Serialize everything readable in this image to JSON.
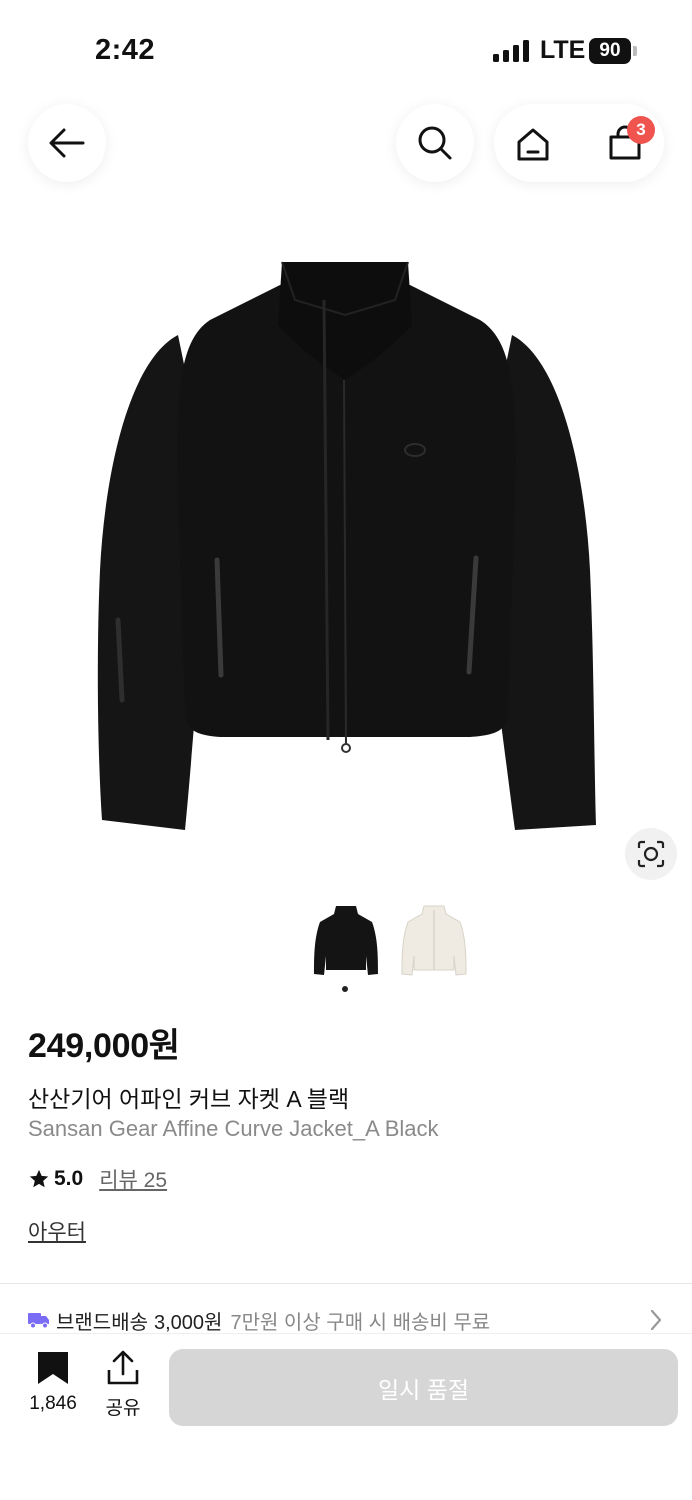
{
  "status_bar": {
    "time": "2:42",
    "network": "LTE",
    "battery": "90"
  },
  "header": {
    "cart_count": "3"
  },
  "product": {
    "price": "249,000원",
    "name_ko": "산산기어 어파인 커브 자켓 A 블랙",
    "name_en": "Sansan Gear Affine Curve Jacket_A Black",
    "rating": "5.0",
    "review_text": "리뷰 25",
    "category": "아우터",
    "image_icon": "black-jacket-image",
    "thumbnails": [
      {
        "icon": "black-jacket-thumbnail",
        "selected": true
      },
      {
        "icon": "ivory-jacket-thumbnail",
        "selected": false
      }
    ]
  },
  "shipping": {
    "icon": "truck-icon",
    "brand_label": "브랜드배송",
    "fee": "3,000원",
    "note": "7만원 이상 구매 시 배송비 무료"
  },
  "bottom_bar": {
    "bookmark_count": "1,846",
    "share_label": "공유",
    "soldout_label": "일시 품절"
  },
  "colors": {
    "badge": "#f0544f",
    "shipping_icon": "#7b6cf6",
    "soldout_bg": "#d6d6d6"
  }
}
